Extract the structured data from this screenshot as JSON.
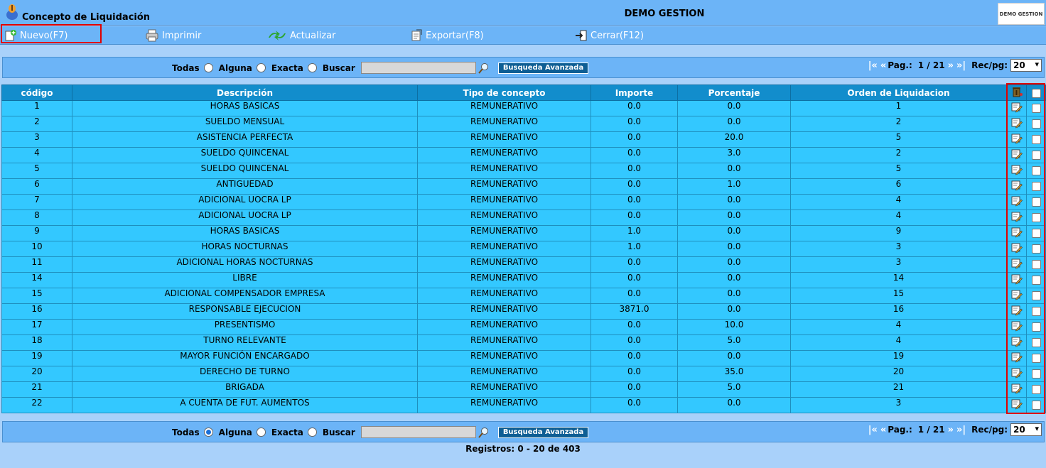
{
  "header": {
    "title": "Concepto de Liquidación",
    "company": "DEMO GESTION",
    "brand_logo_text": "DEMO GESTION"
  },
  "toolbar": {
    "new_label": "Nuevo(F7)",
    "print_label": "Imprimir",
    "refresh_label": "Actualizar",
    "export_label": "Exportar(F8)",
    "close_label": "Cerrar(F12)"
  },
  "search_top": {
    "opt_all": "Todas",
    "opt_some": "Alguna",
    "opt_exact": "Exacta",
    "search_label": "Buscar",
    "search_value": "",
    "advanced_label": "Busqueda Avanzada",
    "selected": "none"
  },
  "search_bottom": {
    "opt_all": "Todas",
    "opt_some": "Alguna",
    "opt_exact": "Exacta",
    "search_label": "Buscar",
    "search_value": "",
    "advanced_label": "Busqueda Avanzada",
    "selected": "all"
  },
  "pager": {
    "first": "|«",
    "prev": "«",
    "page_label": "Pag.:",
    "page_value": "1 / 21",
    "next": "»",
    "last": "»|",
    "recpg_label": "Rec/pg:",
    "recpg_value": "20"
  },
  "table": {
    "headers": [
      "código",
      "Descripción",
      "Tipo de concepto",
      "Importe",
      "Porcentaje",
      "Orden de Liquidacion"
    ],
    "rows": [
      [
        "1",
        "HORAS BASICAS",
        "REMUNERATIVO",
        "0.0",
        "0.0",
        "1"
      ],
      [
        "2",
        "SUELDO MENSUAL",
        "REMUNERATIVO",
        "0.0",
        "0.0",
        "2"
      ],
      [
        "3",
        "ASISTENCIA PERFECTA",
        "REMUNERATIVO",
        "0.0",
        "20.0",
        "5"
      ],
      [
        "4",
        "SUELDO QUINCENAL",
        "REMUNERATIVO",
        "0.0",
        "3.0",
        "2"
      ],
      [
        "5",
        "SUELDO QUINCENAL",
        "REMUNERATIVO",
        "0.0",
        "0.0",
        "5"
      ],
      [
        "6",
        "ANTIGUEDAD",
        "REMUNERATIVO",
        "0.0",
        "1.0",
        "6"
      ],
      [
        "7",
        "ADICIONAL UOCRA LP",
        "REMUNERATIVO",
        "0.0",
        "0.0",
        "4"
      ],
      [
        "8",
        "ADICIONAL UOCRA LP",
        "REMUNERATIVO",
        "0.0",
        "0.0",
        "4"
      ],
      [
        "9",
        "HORAS BASICAS",
        "REMUNERATIVO",
        "1.0",
        "0.0",
        "9"
      ],
      [
        "10",
        "HORAS NOCTURNAS",
        "REMUNERATIVO",
        "1.0",
        "0.0",
        "3"
      ],
      [
        "11",
        "ADICIONAL HORAS NOCTURNAS",
        "REMUNERATIVO",
        "0.0",
        "0.0",
        "3"
      ],
      [
        "14",
        "LIBRE",
        "REMUNERATIVO",
        "0.0",
        "0.0",
        "14"
      ],
      [
        "15",
        "ADICIONAL COMPENSADOR EMPRESA",
        "REMUNERATIVO",
        "0.0",
        "0.0",
        "15"
      ],
      [
        "16",
        "RESPONSABLE EJECUCION",
        "REMUNERATIVO",
        "3871.0",
        "0.0",
        "16"
      ],
      [
        "17",
        "PRESENTISMO",
        "REMUNERATIVO",
        "0.0",
        "10.0",
        "4"
      ],
      [
        "18",
        "TURNO RELEVANTE",
        "REMUNERATIVO",
        "0.0",
        "5.0",
        "4"
      ],
      [
        "19",
        "MAYOR FUNCIÓN ENCARGADO",
        "REMUNERATIVO",
        "0.0",
        "0.0",
        "19"
      ],
      [
        "20",
        "DERECHO DE TURNO",
        "REMUNERATIVO",
        "0.0",
        "35.0",
        "20"
      ],
      [
        "21",
        "BRIGADA",
        "REMUNERATIVO",
        "0.0",
        "5.0",
        "21"
      ],
      [
        "22",
        "A CUENTA DE FUT. AUMENTOS",
        "REMUNERATIVO",
        "0.0",
        "0.0",
        "3"
      ]
    ]
  },
  "footer": {
    "records": "Registros: 0 - 20 de 403"
  },
  "colors": {
    "bar": "#6cb4f7",
    "header_row": "#128dcc",
    "row": "#33c8ff",
    "background": "#a9d1fa",
    "highlight": "#e00000"
  }
}
